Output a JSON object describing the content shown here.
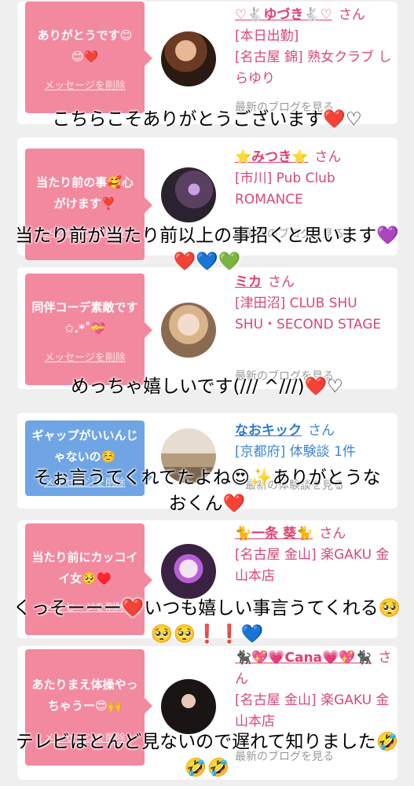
{
  "entries": [
    {
      "message": "ありがとうです😊😊❤️",
      "delete_label": "メッセージを削除",
      "name": "♡🐇ゆづき🐇♡",
      "san": "さん",
      "lines": [
        "[本日出勤]",
        "[名古屋 錦] 熟女クラブ しらゆり"
      ],
      "blog": "最新のブログを見る",
      "caption": "こちらこそありがとうございます❤️♡",
      "color": "pink"
    },
    {
      "message": "当たり前の事🥰心がけます❣️",
      "delete_label": "メッセージを削除",
      "name": "⭐️みつき⭐️",
      "san": "さん",
      "lines": [
        "[市川] Pub Club ROMANCE"
      ],
      "blog": "最新のブログを見る",
      "caption": "当たり前が当たり前以上の事招くと思います💜❤️💙💚",
      "color": "pink"
    },
    {
      "message": "同伴コーデ素敵です✩.*˚💝",
      "delete_label": "メッセージを削除",
      "name": "ミカ",
      "san": "さん",
      "lines": [
        "[津田沼] CLUB SHU SHU・SECOND STAGE"
      ],
      "blog": "最新のブログを見る",
      "caption": "めっちゃ嬉しいです(/// ^///)❤️♡",
      "color": "pink"
    },
    {
      "message": "ギャップがいいんじゃないの☺️",
      "delete_label": "メッセージを削除",
      "name": "なおキック",
      "san": "さん",
      "lines": [
        "[京都府] 体験談 1件"
      ],
      "blog": "最新の体験談を見る",
      "caption": "そぉ言うてくれてたよね😍✨ありがとうなおくん❤️",
      "color": "blue"
    },
    {
      "message": "当たり前にカッコイイ女🥺♥️",
      "delete_label": "メッセージを削除",
      "name": "🐈一条 葵🐈",
      "san": "さん",
      "lines": [
        "[名古屋 金山] 楽GAKU 金山本店"
      ],
      "blog": "最新のブログを見る",
      "caption": "くっそーーー❤️いつも嬉しい事言うてくれる🥺🥺🥺❗️❗️💙",
      "color": "pink"
    },
    {
      "message": "あたりまえ体操やっちゃうー😍🙌",
      "delete_label": "メッセージを削除",
      "name": "🐈‍⬛💖💗Cana💗💖🐈‍⬛",
      "san": "さん",
      "lines": [
        "[名古屋 金山] 楽GAKU 金山本店"
      ],
      "blog": "最新のブログを見る",
      "caption": "テレビほとんど見ないので遅れて知りました🤣🤣🤣",
      "color": "pink"
    }
  ]
}
